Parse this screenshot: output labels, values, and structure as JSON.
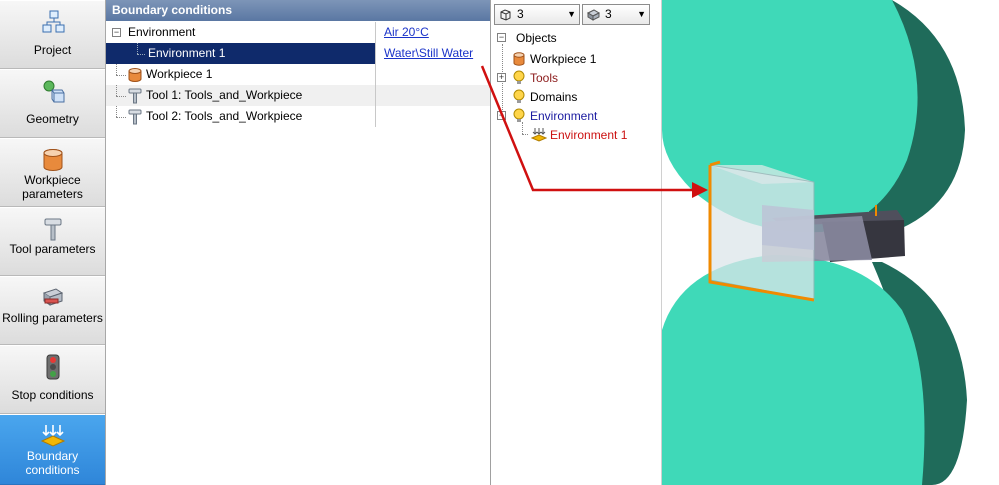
{
  "nav": {
    "items": [
      {
        "label": "Project"
      },
      {
        "label": "Geometry"
      },
      {
        "label": "Workpiece parameters"
      },
      {
        "label": "Tool parameters"
      },
      {
        "label": "Rolling parameters"
      },
      {
        "label": "Stop conditions"
      },
      {
        "label": "Boundary conditions"
      }
    ],
    "active_index": 6,
    "active_color": "#3a93e4"
  },
  "boundary_panel": {
    "title": "Boundary conditions",
    "rows": [
      {
        "name": "Environment",
        "value": "Air 20°C"
      },
      {
        "name": "Environment 1",
        "value": "Water\\Still Water"
      },
      {
        "name": "Workpiece 1",
        "value": ""
      },
      {
        "name": "Tool 1: Tools_and_Workpiece",
        "value": ""
      },
      {
        "name": "Tool 2: Tools_and_Workpiece",
        "value": ""
      }
    ],
    "selected_row_color": "#0f2a6b"
  },
  "tree_panel": {
    "combo_left": {
      "value": "3",
      "icon": "cube-outline-icon"
    },
    "combo_right": {
      "value": "3",
      "icon": "solid-view-icon"
    },
    "nodes": [
      {
        "label": "Objects",
        "color": "#000000"
      },
      {
        "label": "Workpiece 1",
        "color": "#000000"
      },
      {
        "label": "Tools",
        "color": "#8b1a1a"
      },
      {
        "label": "Domains",
        "color": "#000000"
      },
      {
        "label": "Environment",
        "color": "#1a1aa0"
      },
      {
        "label": "Environment 1",
        "color": "#cc1111"
      }
    ]
  },
  "viewport": {
    "roll_color": "#3fd9b8",
    "roll_side_color": "#1f6b5a",
    "workpiece_highlight": "#f08a00",
    "arrow_color": "#d01010"
  }
}
